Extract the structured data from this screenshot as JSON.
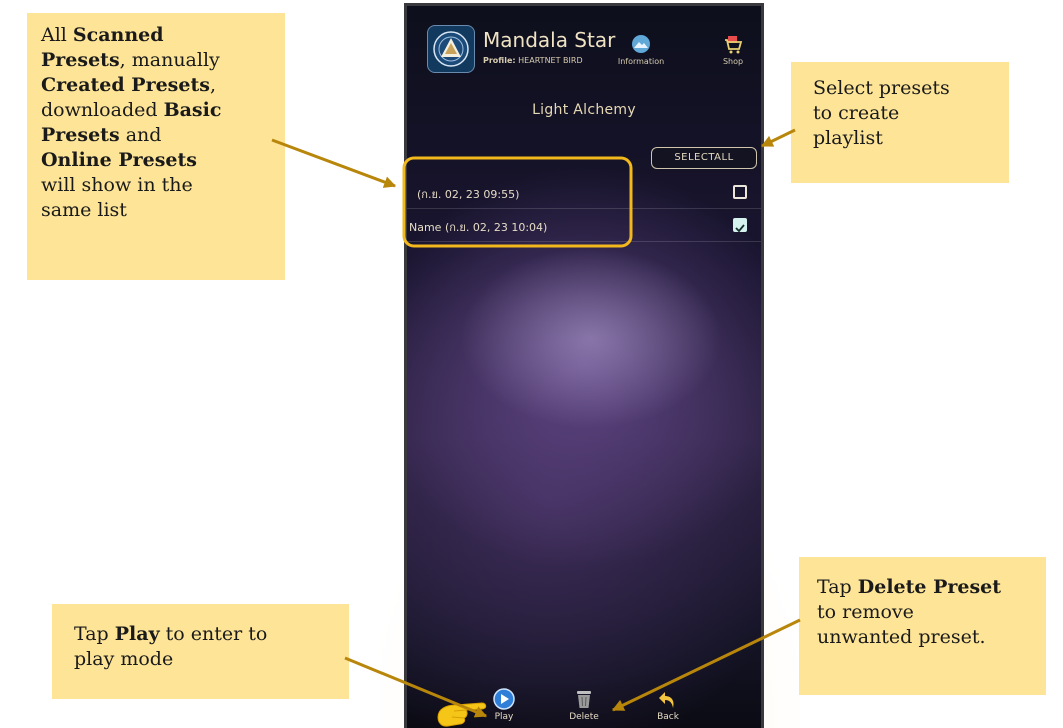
{
  "app": {
    "title": "Mandala Star",
    "profile_label": "Profile:",
    "profile_name": "HEARTNET BIRD",
    "information_label": "Information",
    "shop_label": "Shop",
    "screen_title": "Light Alchemy",
    "select_all_label": "SELECTALL"
  },
  "presets": [
    {
      "label": "(ก.ย. 02, 23 09:55)",
      "checked": false
    },
    {
      "label": "Name (ก.ย. 02, 23 10:04)",
      "checked": true
    }
  ],
  "footer": {
    "play_label": "Play",
    "delete_label": "Delete",
    "back_label": "Back"
  },
  "notes": {
    "presets_list": {
      "w1": "All",
      "b1": "Scanned",
      "b2": "Presets",
      "w2": ", manually",
      "b3": "Created Presets",
      "w3": ",",
      "w4": "downloaded",
      "b4": "Basic",
      "b5": "Presets",
      "w5": "and",
      "b6": "Online Presets",
      "w6": "will show in the",
      "w7": "same list"
    },
    "select": {
      "line1": "Select presets",
      "line2": "to create",
      "line3": "playlist"
    },
    "play": {
      "w1": "Tap",
      "b1": "Play",
      "w2": "to enter to",
      "line2": "play mode"
    },
    "delete": {
      "w1": "Tap",
      "b1": "Delete Preset",
      "line2": "to remove",
      "line3": "unwanted preset."
    }
  },
  "colors": {
    "callout": "#fde497",
    "arrow": "#b8860b",
    "highlight": "#f2b81c",
    "checkbox_checked": "#d6f2ee"
  },
  "icons": [
    "mandala-logo-icon",
    "information-icon",
    "shop-cart-icon",
    "play-icon",
    "trash-icon",
    "back-arrow-icon",
    "pointing-hand-icon"
  ]
}
